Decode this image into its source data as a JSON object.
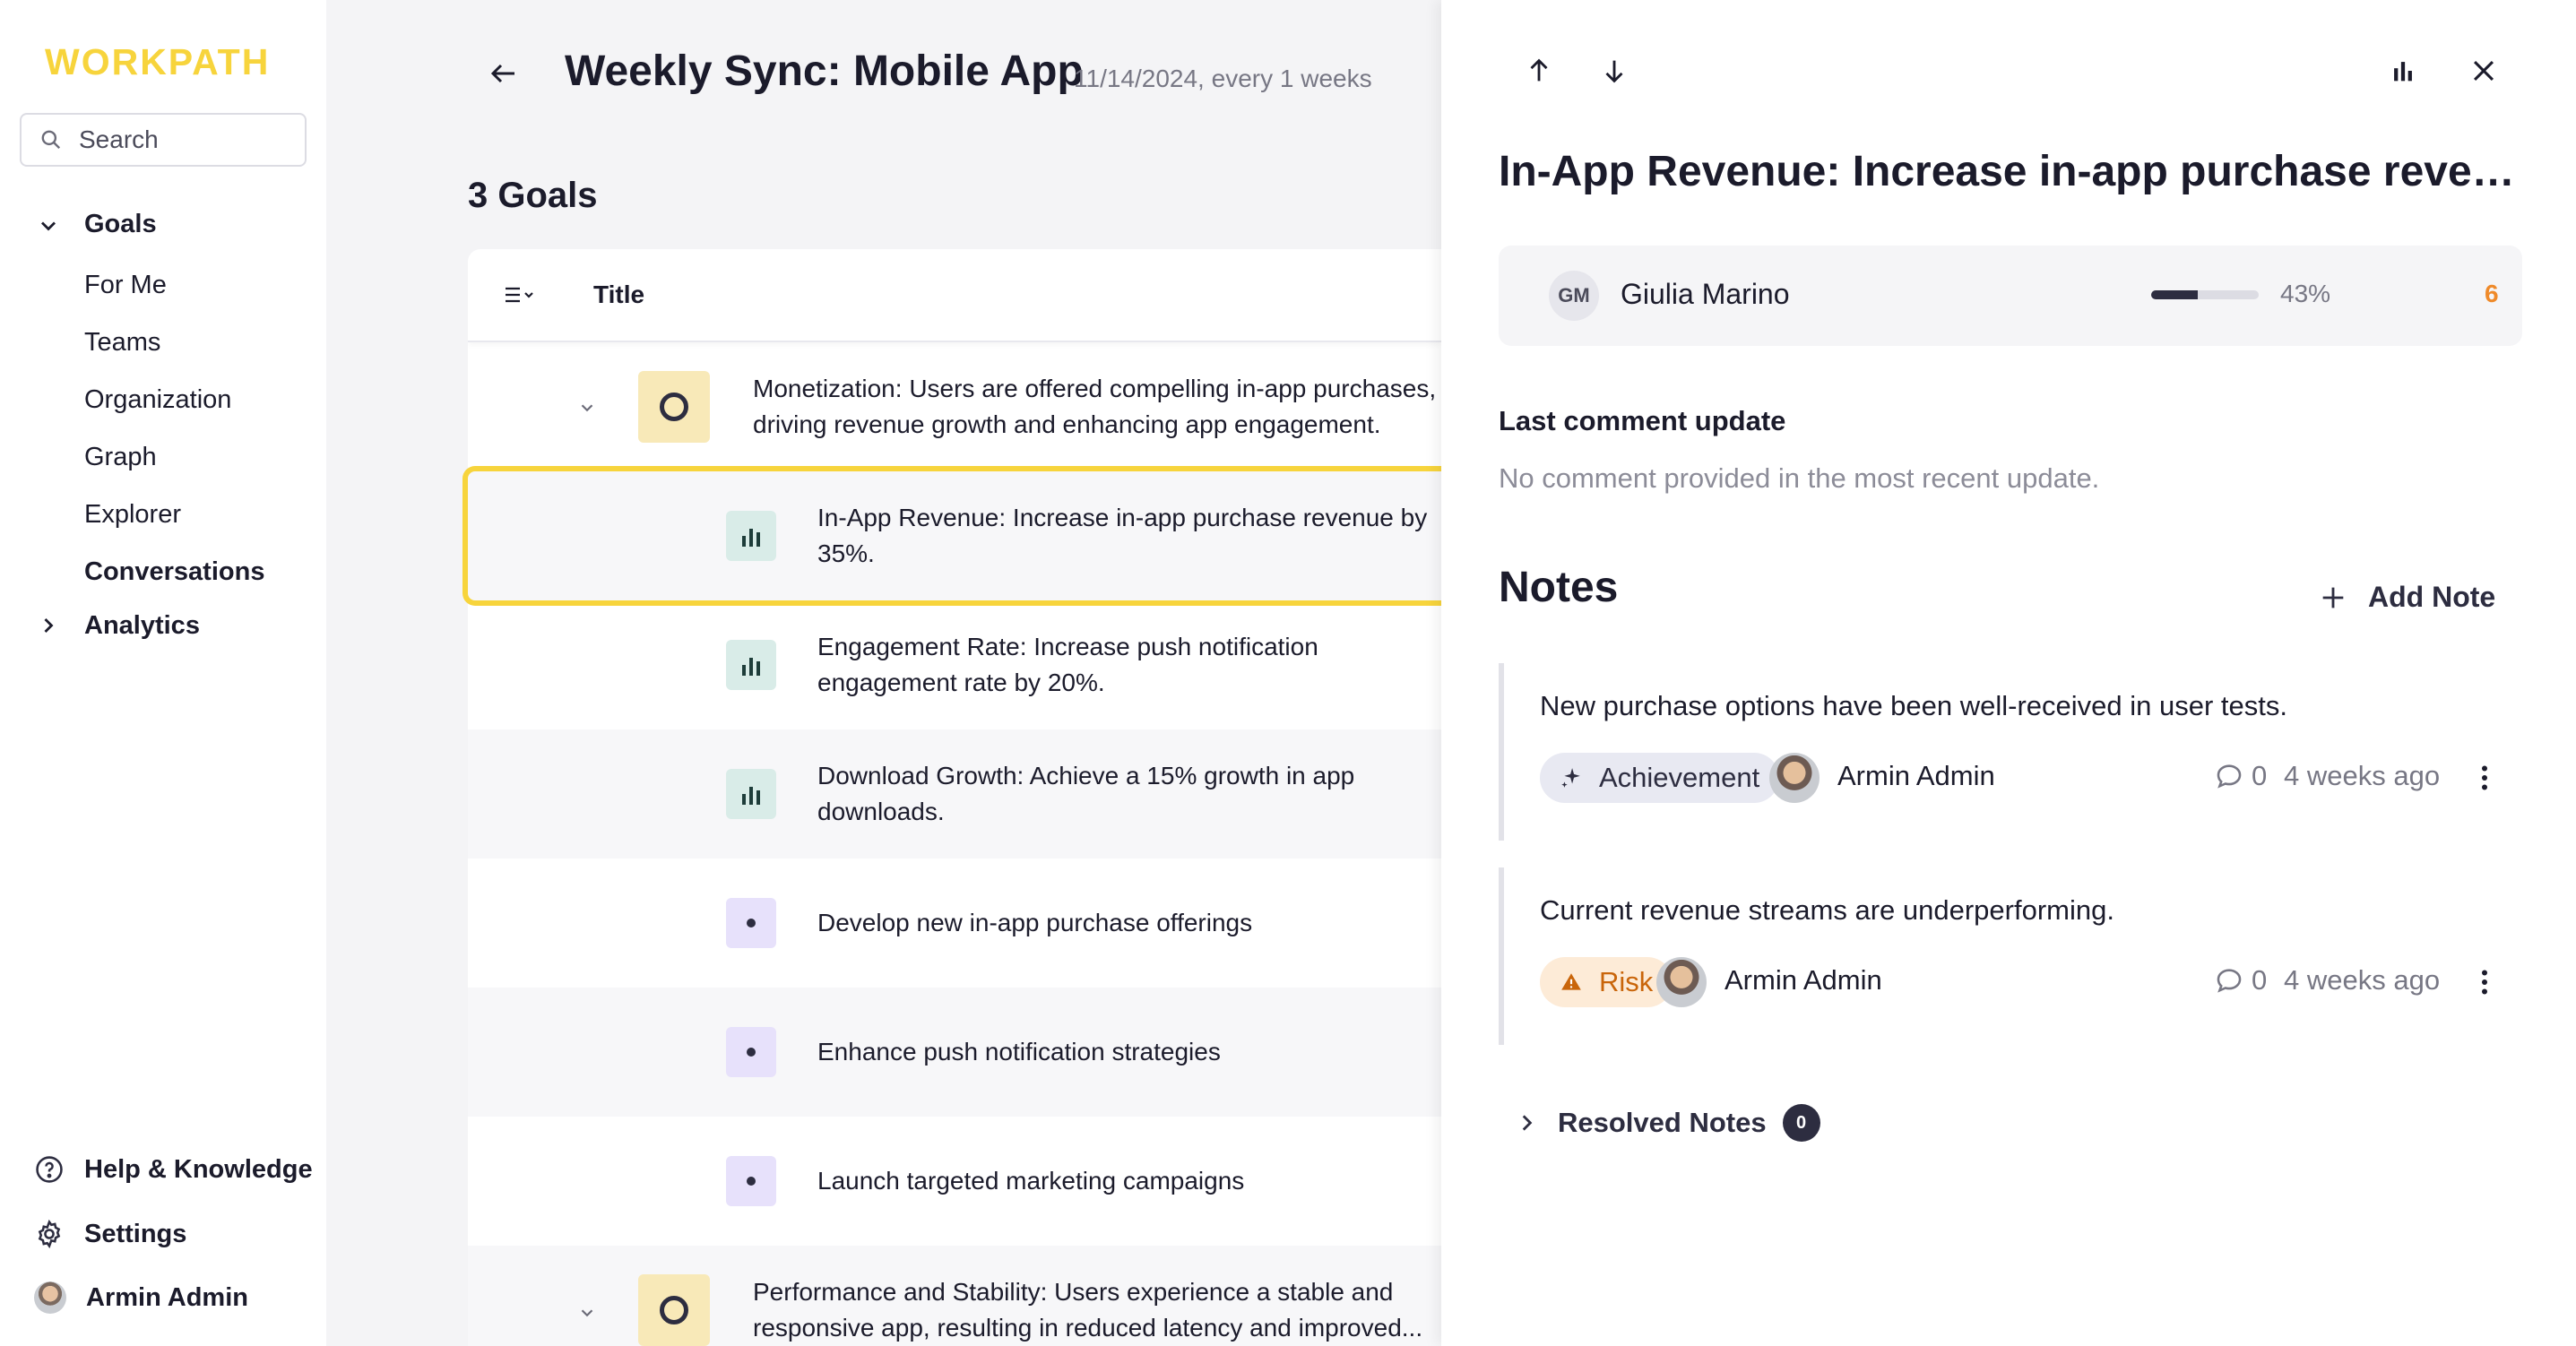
{
  "app": {
    "logo": "WORKPATH"
  },
  "sidebar": {
    "search_placeholder": "Search",
    "goals_label": "Goals",
    "items": [
      {
        "label": "For Me"
      },
      {
        "label": "Teams"
      },
      {
        "label": "Organization"
      },
      {
        "label": "Graph"
      },
      {
        "label": "Explorer"
      },
      {
        "label": "Conversations"
      }
    ],
    "analytics_label": "Analytics",
    "help_label": "Help & Knowledge",
    "settings_label": "Settings",
    "user_name": "Armin Admin"
  },
  "main": {
    "title": "Weekly Sync: Mobile App",
    "meta": "11/14/2024, every 1 weeks",
    "goals_count": "3 Goals",
    "column_title": "Title",
    "rows": [
      {
        "type": "objective",
        "line1": "Monetization: Users are offered compelling in-app purchases,",
        "line2": "driving revenue growth and enhancing app engagement."
      },
      {
        "type": "key-result",
        "line1": "In-App Revenue: Increase in-app purchase revenue by",
        "line2": "35%."
      },
      {
        "type": "key-result",
        "line1": "Engagement Rate: Increase push notification",
        "line2": "engagement rate by 20%."
      },
      {
        "type": "key-result",
        "line1": "Download Growth: Achieve a 15% growth in app",
        "line2": "downloads."
      },
      {
        "type": "initiative",
        "line1": "Develop new in-app purchase offerings"
      },
      {
        "type": "initiative",
        "line1": "Enhance push notification strategies"
      },
      {
        "type": "initiative",
        "line1": "Launch targeted marketing campaigns"
      },
      {
        "type": "objective",
        "line1": "Performance and Stability: Users experience a stable and",
        "line2": "responsive app, resulting in reduced latency and improved..."
      }
    ]
  },
  "panel": {
    "title": "In-App Revenue: Increase in-app purchase revenue ...",
    "owner_initials": "GM",
    "owner_name": "Giulia Marino",
    "progress_percent": 43,
    "progress_text": "43%",
    "count": "6",
    "last_comment_heading": "Last comment update",
    "last_comment_text": "No comment provided in the most recent update.",
    "notes_heading": "Notes",
    "add_note_label": "Add Note",
    "notes": [
      {
        "text": "New purchase options have been well-received in user tests.",
        "tag": "Achievement",
        "author": "Armin Admin",
        "comments": "0",
        "time": "4 weeks ago"
      },
      {
        "text": "Current revenue streams are underperforming.",
        "tag": "Risk",
        "author": "Armin Admin",
        "comments": "0",
        "time": "4 weeks ago"
      }
    ],
    "resolved_label": "Resolved Notes",
    "resolved_count": "0"
  },
  "colors": {
    "brand_yellow": "#f7d43c",
    "accent_dark": "#2d2d40",
    "risk_orange": "#c9650a",
    "count_orange": "#ef8a2a"
  }
}
